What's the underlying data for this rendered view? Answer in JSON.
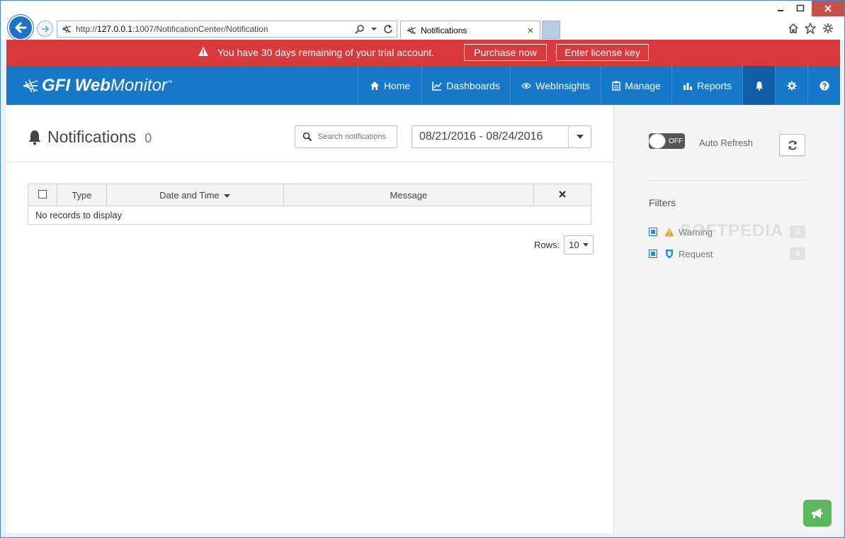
{
  "browser": {
    "url_prefix": "http://",
    "url_host": "127.0.0.1",
    "url_rest": ":1007/NotificationCenter/Notification",
    "tab_title": "Notifications"
  },
  "banner": {
    "message": "You have 30 days remaining of your trial account.",
    "purchase_label": "Purchase now",
    "separator": "·",
    "license_label": "Enter license key"
  },
  "app": {
    "logo_bold": "GFI Web",
    "logo_rest": "Monitor",
    "logo_tm": "™",
    "menu": {
      "home": "Home",
      "dashboards": "Dashboards",
      "webinsights": "WebInsights",
      "manage": "Manage",
      "reports": "Reports"
    }
  },
  "page": {
    "title": "Notifications",
    "count": "0",
    "search_placeholder": "Search notifications",
    "date_range": "08/21/2016 - 08/24/2016"
  },
  "table": {
    "columns": {
      "type": "Type",
      "datetime": "Date and Time",
      "message": "Message"
    },
    "empty_text": "No records to display",
    "rows_label": "Rows:",
    "rows_value": "10"
  },
  "sidebar": {
    "toggle_label": "OFF",
    "auto_refresh": "Auto Refresh",
    "filters_title": "Filters",
    "filters": [
      {
        "label": "Warning",
        "count": "0"
      },
      {
        "label": "Request",
        "count": "0"
      }
    ],
    "watermark": "SOFTPEDIA"
  },
  "colors": {
    "banner": "#d9393b",
    "appbar": "#1578c9",
    "feedback": "#5cb85c"
  }
}
